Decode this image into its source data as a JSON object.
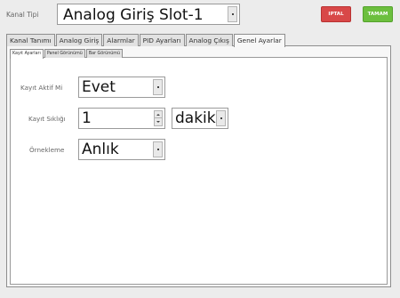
{
  "header": {
    "kanal_tipi_label": "Kanal Tipi",
    "kanal_tipi_value": "Analog Giriş Slot-1",
    "iptal_label": "IPTAL",
    "tamam_label": "TAMAM"
  },
  "tabs": [
    {
      "label": "Kanal Tanımı",
      "active": false
    },
    {
      "label": "Analog Giriş",
      "active": false
    },
    {
      "label": "Alarmlar",
      "active": false
    },
    {
      "label": "PID Ayarları",
      "active": false
    },
    {
      "label": "Analog Çıkış",
      "active": false
    },
    {
      "label": "Genel Ayarlar",
      "active": true
    }
  ],
  "subtabs": [
    {
      "label": "Kayıt Ayarları",
      "active": true
    },
    {
      "label": "Panel Görünümü",
      "active": false
    },
    {
      "label": "Bar Görünümü",
      "active": false
    }
  ],
  "form": {
    "kayit_aktif_label": "Kayıt Aktif Mi",
    "kayit_aktif_value": "Evet",
    "kayit_sikligi_label": "Kayıt Sıklığı",
    "kayit_sikligi_value": "1",
    "kayit_birim_value": "dakika",
    "ornekleme_label": "Örnekleme",
    "ornekleme_value": "Anlık"
  },
  "colors": {
    "iptal": "#d84848",
    "tamam": "#6cbf3e"
  }
}
